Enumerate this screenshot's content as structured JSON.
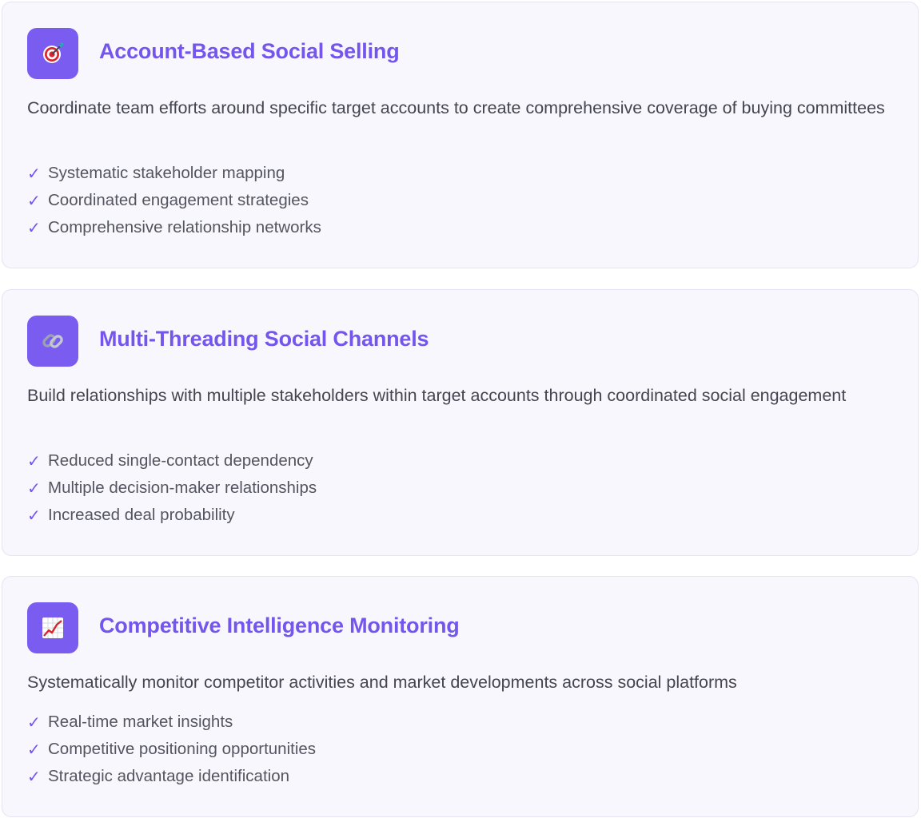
{
  "cards": [
    {
      "icon": "target-icon",
      "title": "Account-Based Social Selling",
      "description": "Coordinate team efforts around specific target accounts to create comprehensive coverage of buying committees",
      "benefits": [
        "Systematic stakeholder mapping",
        "Coordinated engagement strategies",
        "Comprehensive relationship networks"
      ]
    },
    {
      "icon": "link-icon",
      "title": "Multi-Threading Social Channels",
      "description": "Build relationships with multiple stakeholders within target accounts through coordinated social engagement",
      "benefits": [
        "Reduced single-contact dependency",
        "Multiple decision-maker relationships",
        "Increased deal probability"
      ]
    },
    {
      "icon": "chart-increasing-icon",
      "title": "Competitive Intelligence Monitoring",
      "description": "Systematically monitor competitor activities and market developments across social platforms",
      "benefits": [
        "Real-time market insights",
        "Competitive positioning opportunities",
        "Strategic advantage identification"
      ]
    }
  ],
  "check_mark": "✓",
  "colors": {
    "accent": "#7456ec",
    "icon_background": "#7a5cf0",
    "card_background": "#f8f7fe",
    "card_border": "#e6e3f4",
    "body_text": "#45454f"
  }
}
